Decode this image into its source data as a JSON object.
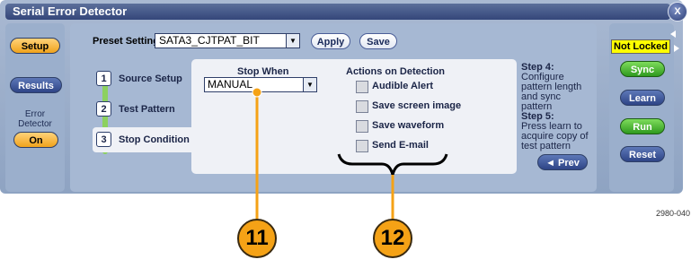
{
  "window": {
    "title": "Serial Error Detector",
    "close_label": "X"
  },
  "sidebar": {
    "setup_label": "Setup",
    "results_label": "Results",
    "error_detector_label": "Error Detector",
    "on_label": "On"
  },
  "preset": {
    "label": "Preset Setting",
    "value": "SATA3_CJTPAT_BIT",
    "apply_label": "Apply",
    "save_label": "Save"
  },
  "steps": [
    {
      "num": "1",
      "label": "Source Setup"
    },
    {
      "num": "2",
      "label": "Test Pattern"
    },
    {
      "num": "3",
      "label": "Stop Condition"
    }
  ],
  "stop_when": {
    "label": "Stop When",
    "value": "MANUAL"
  },
  "actions": {
    "label": "Actions on Detection",
    "items": [
      {
        "label": "Audible Alert",
        "checked": false
      },
      {
        "label": "Save screen image",
        "checked": false
      },
      {
        "label": "Save waveform",
        "checked": false
      },
      {
        "label": "Send E-mail",
        "checked": false
      }
    ]
  },
  "help": {
    "step4_title": "Step 4:",
    "step4_text": "Configure pattern length and sync pattern",
    "step5_title": "Step 5:",
    "step5_text": "Press learn to acquire copy of test pattern",
    "prev_label": "◄ Prev"
  },
  "status": {
    "label": "Not Locked"
  },
  "right_buttons": {
    "sync_label": "Sync",
    "learn_label": "Learn",
    "run_label": "Run",
    "reset_label": "Reset"
  },
  "figure_id": "2980-040",
  "callouts": [
    "11",
    "12"
  ],
  "colors": {
    "accent_orange": "#f0a21c",
    "accent_green": "#2f9a1e",
    "status_yellow": "#ffff00",
    "panel_blue": "#a9b9d2"
  }
}
